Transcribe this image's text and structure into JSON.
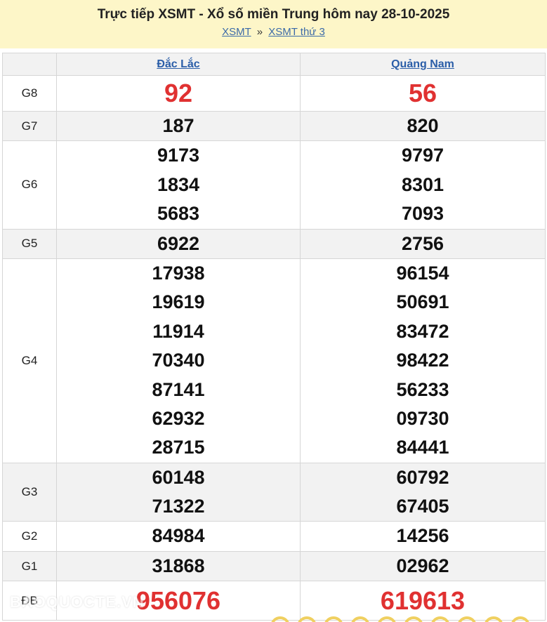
{
  "header": {
    "title": "Trực tiếp XSMT - Xổ số miền Trung hôm nay 28-10-2025",
    "breadcrumb": {
      "home": "XSMT",
      "separator": "»",
      "current": "XSMT thứ 3"
    }
  },
  "provinces": [
    "Đắc Lắc",
    "Quảng Nam"
  ],
  "prizes": [
    {
      "label": "G8",
      "p1": [
        "92"
      ],
      "p2": [
        "56"
      ]
    },
    {
      "label": "G7",
      "p1": [
        "187"
      ],
      "p2": [
        "820"
      ]
    },
    {
      "label": "G6",
      "p1": [
        "9173",
        "1834",
        "5683"
      ],
      "p2": [
        "9797",
        "8301",
        "7093"
      ]
    },
    {
      "label": "G5",
      "p1": [
        "6922"
      ],
      "p2": [
        "2756"
      ]
    },
    {
      "label": "G4",
      "p1": [
        "17938",
        "19619",
        "11914",
        "70340",
        "87141",
        "62932",
        "28715"
      ],
      "p2": [
        "96154",
        "50691",
        "83472",
        "98422",
        "56233",
        "09730",
        "84441"
      ]
    },
    {
      "label": "G3",
      "p1": [
        "60148",
        "71322"
      ],
      "p2": [
        "60792",
        "67405"
      ]
    },
    {
      "label": "G2",
      "p1": [
        "84984"
      ],
      "p2": [
        "14256"
      ]
    },
    {
      "label": "G1",
      "p1": [
        "31868"
      ],
      "p2": [
        "02962"
      ]
    },
    {
      "label": "ĐB",
      "p1": [
        "956076"
      ],
      "p2": [
        "619613"
      ]
    }
  ],
  "watermark": "BAOQUOCTE.VN",
  "colors": {
    "header_bg": "#fdf6c8",
    "link": "#2b5ea8",
    "special": "#e03131",
    "alt_row": "#f2f2f2"
  }
}
